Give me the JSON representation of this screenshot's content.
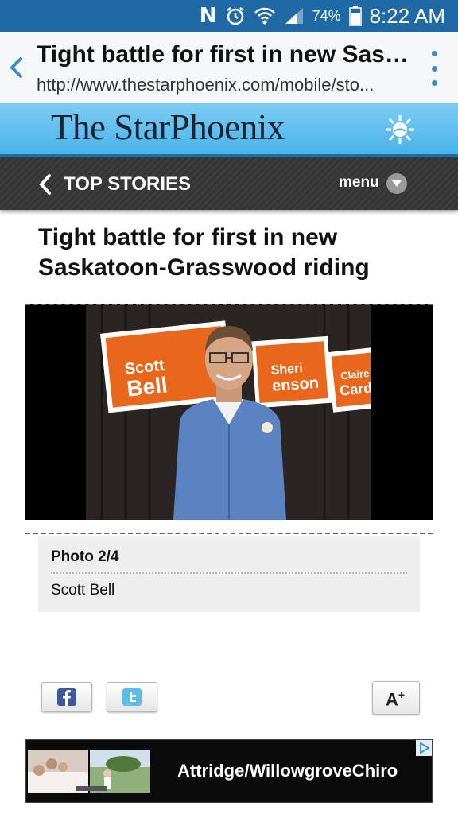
{
  "status_bar": {
    "battery_percent": "74%",
    "time": "8:22 AM",
    "icons": [
      "n-notification-icon",
      "alarm-icon",
      "wifi-icon",
      "signal-icon",
      "battery-icon"
    ]
  },
  "browser": {
    "page_title": "Tight battle for first in new Sask...",
    "url": "http://www.thestarphoenix.com/mobile/sto..."
  },
  "masthead": {
    "logo_text": "The StarPhoenix"
  },
  "nav": {
    "section_label": "TOP STORIES",
    "menu_label": "menu"
  },
  "article": {
    "headline": "Tight battle for first in new Saskatoon-Grasswood riding",
    "photo": {
      "sign_1_first": "Scott",
      "sign_1_last": "Bell",
      "sign_2_first": "Sheri",
      "sign_2_last": "enson",
      "sign_3_first": "Claire",
      "sign_3_last": "Card"
    },
    "caption": {
      "count": "Photo 2/4",
      "text": "Scott Bell"
    }
  },
  "tools": {
    "font_size_label": "A",
    "font_size_sup": "+"
  },
  "ad": {
    "text": "Attridge/WillowgroveChiro"
  },
  "colors": {
    "status_bar": "#1f6aa5",
    "masthead": "#4ab2ea",
    "nav_bar": "#383838",
    "accent_orange": "#e8671c"
  }
}
